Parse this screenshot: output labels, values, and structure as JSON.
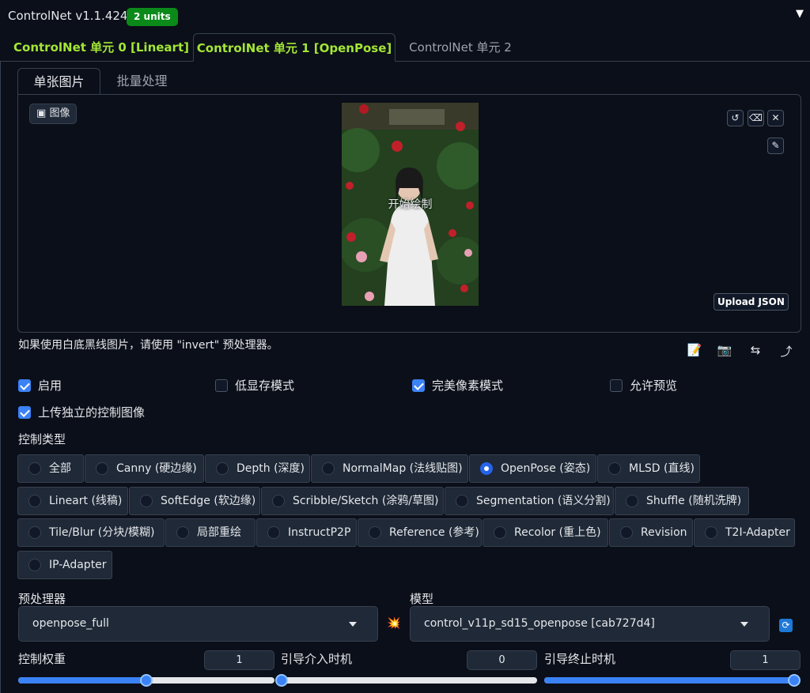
{
  "header": {
    "title": "ControlNet v1.1.424",
    "units_badge": "2 units",
    "collapse_icon": "triangle-down-icon"
  },
  "unit_tabs": [
    {
      "label": "ControlNet 单元 0 [Lineart]",
      "active": false
    },
    {
      "label": "ControlNet 单元 1 [OpenPose]",
      "active": true
    },
    {
      "label": "ControlNet 单元 2",
      "active": false
    }
  ],
  "sub_tabs": [
    {
      "label": "单张图片",
      "active": true
    },
    {
      "label": "批量处理",
      "active": false
    }
  ],
  "image_panel": {
    "label": "图像",
    "overlay_text": "开始绘制",
    "upload_json_label": "Upload JSON",
    "tool_icons": [
      "undo-icon",
      "eraser-icon",
      "close-icon",
      "brush-icon"
    ]
  },
  "hint_text": "如果使用白底黑线图片，请使用 \"invert\" 预处理器。",
  "action_icons": [
    "notepad-icon",
    "camera-icon",
    "swap-icon",
    "send-icon"
  ],
  "checkboxes": [
    {
      "label": "启用",
      "checked": true
    },
    {
      "label": "低显存模式",
      "checked": false
    },
    {
      "label": "完美像素模式",
      "checked": true
    },
    {
      "label": "允许预览",
      "checked": false
    },
    {
      "label": "上传独立的控制图像",
      "checked": true
    }
  ],
  "control_type": {
    "label": "控制类型",
    "options": [
      "全部",
      "Canny (硬边缘)",
      "Depth (深度)",
      "NormalMap (法线贴图)",
      "OpenPose (姿态)",
      "MLSD (直线)",
      "Lineart (线稿)",
      "SoftEdge (软边缘)",
      "Scribble/Sketch (涂鸦/草图)",
      "Segmentation (语义分割)",
      "Shuffle (随机洗牌)",
      "Tile/Blur (分块/模糊)",
      "局部重绘",
      "InstructP2P",
      "Reference (参考)",
      "Recolor (重上色)",
      "Revision",
      "T2I-Adapter",
      "IP-Adapter"
    ],
    "selected": "OpenPose (姿态)"
  },
  "preprocessor": {
    "label": "预处理器",
    "value": "openpose_full",
    "run_icon": "explosion-icon"
  },
  "model": {
    "label": "模型",
    "value": "control_v11p_sd15_openpose [cab727d4]",
    "refresh_icon": "refresh-icon"
  },
  "sliders": [
    {
      "label": "控制权重",
      "value": "1",
      "fraction": 0.5
    },
    {
      "label": "引导介入时机",
      "value": "0",
      "fraction": 0.0
    },
    {
      "label": "引导终止时机",
      "value": "1",
      "fraction": 1.0
    }
  ],
  "colors": {
    "accent": "#3b82f6",
    "tab_active": "#a3e635",
    "badge": "#0b8a1a",
    "background": "#0b0f19"
  }
}
